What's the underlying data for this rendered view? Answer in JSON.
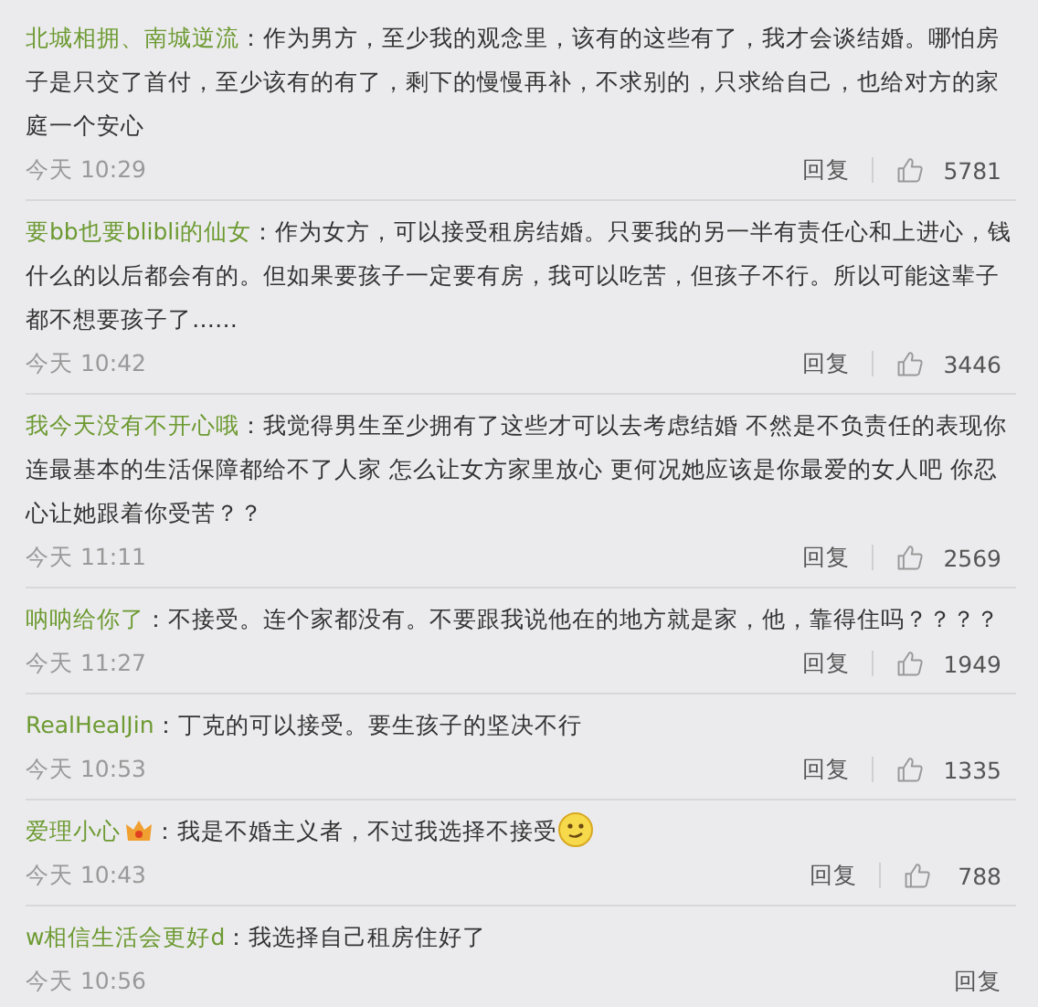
{
  "comments": [
    {
      "user": "北城相拥、南城逆流",
      "text": "：作为男方，至少我的观念里，该有的这些有了，我才会谈结婚。哪怕房子是只交了首付，至少该有的有了，剩下的慢慢再补，不求别的，只求给自己，也给对方的家庭一个安心",
      "time": "今天 10:29",
      "reply": "回复",
      "likes": "5781"
    },
    {
      "user": "要bb也要blibli的仙女",
      "text": "：作为女方，可以接受租房结婚。只要我的另一半有责任心和上进心，钱什么的以后都会有的。但如果要孩子一定要有房，我可以吃苦，但孩子不行。所以可能这辈子都不想要孩子了……",
      "time": "今天 10:42",
      "reply": "回复",
      "likes": "3446"
    },
    {
      "user": "我今天没有不开心哦",
      "text": "：我觉得男生至少拥有了这些才可以去考虑结婚 不然是不负责任的表现你连最基本的生活保障都给不了人家 怎么让女方家里放心 更何况她应该是你最爱的女人吧 你忍心让她跟着你受苦？？",
      "time": "今天 11:11",
      "reply": "回复",
      "likes": "2569"
    },
    {
      "user": "呐呐给你了",
      "text": "：不接受。连个家都没有。不要跟我说他在的地方就是家，他，靠得住吗？？？？",
      "time": "今天 11:27",
      "reply": "回复",
      "likes": "1949"
    },
    {
      "user": "RealHealJin",
      "text": "：丁克的可以接受。要生孩子的坚决不行",
      "time": "今天 10:53",
      "reply": "回复",
      "likes": "1335"
    },
    {
      "user": "爱理小心",
      "user_badge": true,
      "text": "：我是不婚主义者，不过我选择不接受",
      "emoji": true,
      "time": "今天 10:43",
      "reply": "回复",
      "likes": "788"
    },
    {
      "user": "w相信生活会更好d",
      "text": "：我选择自己租房住好了",
      "time": "今天 10:56",
      "reply": "回复"
    }
  ]
}
